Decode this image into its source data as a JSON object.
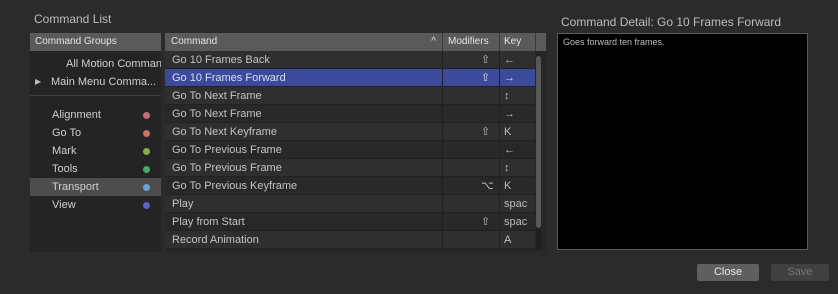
{
  "titles": {
    "command_list": "Command List",
    "command_detail": "Command Detail: Go 10 Frames Forward"
  },
  "groups_panel": {
    "header": "Command Groups",
    "items": [
      {
        "label": "All Motion Comman...",
        "has_arrow": false
      },
      {
        "label": "Main Menu Comma...",
        "has_arrow": true
      }
    ],
    "categories": [
      {
        "label": "Alignment",
        "color": "#c76b78",
        "selected": false
      },
      {
        "label": "Go To",
        "color": "#c8735f",
        "selected": false
      },
      {
        "label": "Mark",
        "color": "#8aa94a",
        "selected": false
      },
      {
        "label": "Tools",
        "color": "#4aa86a",
        "selected": false
      },
      {
        "label": "Transport",
        "color": "#6aa0d4",
        "selected": true
      },
      {
        "label": "View",
        "color": "#5b63c7",
        "selected": false
      }
    ]
  },
  "table": {
    "headers": {
      "command": "Command",
      "sort_icon": "^",
      "modifiers": "Modifiers",
      "key": "Key"
    },
    "rows": [
      {
        "command": "Go 10 Frames Back",
        "modifier": "⇧",
        "key": "←",
        "selected": false
      },
      {
        "command": "Go 10 Frames Forward",
        "modifier": "⇧",
        "key": "→",
        "selected": true
      },
      {
        "command": "Go To Next Frame",
        "modifier": "",
        "key": "↕",
        "selected": false
      },
      {
        "command": "Go To Next Frame",
        "modifier": "",
        "key": "→",
        "selected": false
      },
      {
        "command": "Go To Next Keyframe",
        "modifier": "⇧",
        "key": "K",
        "selected": false
      },
      {
        "command": "Go To Previous Frame",
        "modifier": "",
        "key": "←",
        "selected": false
      },
      {
        "command": "Go To Previous Frame",
        "modifier": "",
        "key": "↕",
        "selected": false
      },
      {
        "command": "Go To Previous Keyframe",
        "modifier": "⌥",
        "key": "K",
        "selected": false
      },
      {
        "command": "Play",
        "modifier": "",
        "key": "spac",
        "selected": false
      },
      {
        "command": "Play from Start",
        "modifier": "⇧",
        "key": "spac",
        "selected": false
      },
      {
        "command": "Record Animation",
        "modifier": "",
        "key": "A",
        "selected": false
      }
    ]
  },
  "detail": {
    "text": "Goes forward ten frames."
  },
  "buttons": {
    "close": "Close",
    "save": "Save"
  },
  "colors": {
    "selection": "#3c4a9c",
    "accent_light": "#6aa0d4"
  }
}
